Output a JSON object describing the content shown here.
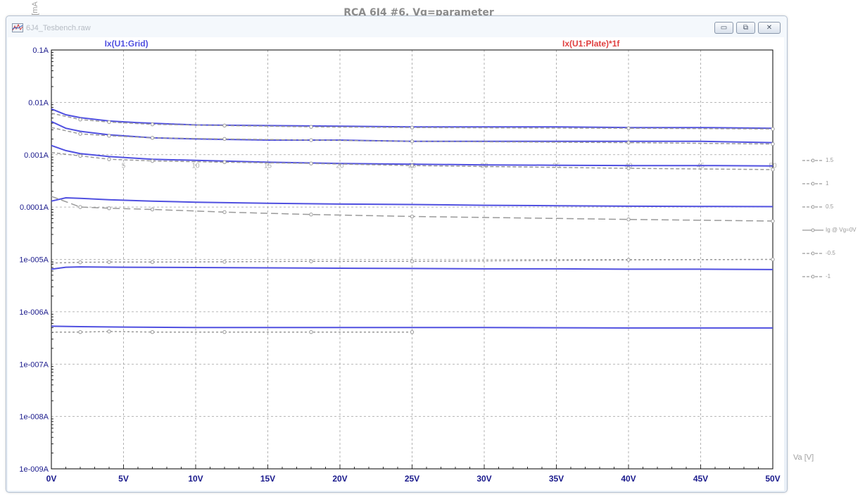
{
  "page": {
    "title": "RCA 6J4 #6, Vg=parameter",
    "left_axis_label": "Ig [mA"
  },
  "window": {
    "title": "6J4_Tesbench.raw",
    "icon": "waveform-icon",
    "buttons": [
      {
        "name": "minimize-button",
        "icon": "minimize-icon",
        "glyph": "▭"
      },
      {
        "name": "restore-button",
        "icon": "restore-icon",
        "glyph": "⧉"
      },
      {
        "name": "close-button",
        "icon": "close-icon",
        "glyph": "✕"
      }
    ]
  },
  "legend_labels": [
    "Ix(U1:Grid)",
    "Ix(U1:Plate)*1f"
  ],
  "side_legend": [
    {
      "label": "1.5",
      "style": "dashed"
    },
    {
      "label": "1",
      "style": "dashed"
    },
    {
      "label": "0.5",
      "style": "dashed"
    },
    {
      "label": "Ig @ Vg=0V",
      "style": "solid"
    },
    {
      "label": "-0.5",
      "style": "dashed"
    },
    {
      "label": "-1",
      "style": "dashed"
    }
  ],
  "xaxis_external_label": "Va [V]",
  "colors": {
    "grid_series": "#5050e0",
    "plate_label": "#e04040",
    "reference": "#9a9a9a",
    "grid_lines": "#a0a0a0",
    "axis": "#000000"
  },
  "chart_data": {
    "type": "line",
    "x_scale": "linear",
    "y_scale": "log",
    "xlim": [
      0,
      50
    ],
    "ylim": [
      1e-09,
      0.1
    ],
    "grid": true,
    "x_tick_labels": [
      "0V",
      "5V",
      "10V",
      "15V",
      "20V",
      "25V",
      "30V",
      "35V",
      "40V",
      "45V",
      "50V"
    ],
    "y_tick_labels": [
      "0.1A",
      "0.01A",
      "0.001A",
      "0.0001A",
      "1e-005A",
      "1e-006A",
      "1e-007A",
      "1e-008A",
      "1e-009A"
    ],
    "inner_x_tick_labels": [
      "5",
      "10",
      "15",
      "20",
      "25",
      "30",
      "35",
      "40",
      "45",
      "50"
    ],
    "series": [
      {
        "name": "Ix(U1:Grid)",
        "style": "solid-blue",
        "points": [
          [
            0,
            0.0075
          ],
          [
            1,
            0.0058
          ],
          [
            2,
            0.0051
          ],
          [
            4,
            0.0044
          ],
          [
            6,
            0.0041
          ],
          [
            10,
            0.0037
          ],
          [
            15,
            0.0036
          ],
          [
            20,
            0.0035
          ],
          [
            25,
            0.0034
          ],
          [
            30,
            0.0034
          ],
          [
            35,
            0.0034
          ],
          [
            40,
            0.0033
          ],
          [
            45,
            0.0033
          ],
          [
            50,
            0.0032
          ]
        ]
      },
      {
        "name": "Ix(U1:Grid)",
        "style": "solid-blue",
        "points": [
          [
            0,
            0.0043
          ],
          [
            1,
            0.0032
          ],
          [
            2,
            0.0028
          ],
          [
            4,
            0.0024
          ],
          [
            7,
            0.0021
          ],
          [
            10,
            0.002
          ],
          [
            15,
            0.0019
          ],
          [
            20,
            0.0019
          ],
          [
            25,
            0.0018
          ],
          [
            30,
            0.0018
          ],
          [
            35,
            0.0018
          ],
          [
            40,
            0.0018
          ],
          [
            45,
            0.0018
          ],
          [
            50,
            0.0017
          ]
        ]
      },
      {
        "name": "Ix(U1:Grid)",
        "style": "solid-blue",
        "points": [
          [
            0,
            0.0015
          ],
          [
            1,
            0.0012
          ],
          [
            2,
            0.00105
          ],
          [
            4,
            0.00092
          ],
          [
            7,
            0.00082
          ],
          [
            10,
            0.00078
          ],
          [
            15,
            0.00072
          ],
          [
            20,
            0.00068
          ],
          [
            25,
            0.00066
          ],
          [
            30,
            0.00064
          ],
          [
            35,
            0.00063
          ],
          [
            40,
            0.00062
          ],
          [
            45,
            0.00062
          ],
          [
            50,
            0.00061
          ]
        ]
      },
      {
        "name": "Ix(U1:Grid)",
        "style": "solid-blue",
        "points": [
          [
            0,
            0.00013
          ],
          [
            1,
            0.00015
          ],
          [
            2,
            0.000147
          ],
          [
            4,
            0.000138
          ],
          [
            7,
            0.00013
          ],
          [
            10,
            0.000124
          ],
          [
            15,
            0.000118
          ],
          [
            20,
            0.000114
          ],
          [
            25,
            0.000112
          ],
          [
            30,
            0.000108
          ],
          [
            35,
            0.000106
          ],
          [
            40,
            0.000104
          ],
          [
            45,
            0.000103
          ],
          [
            50,
            0.000102
          ]
        ]
      },
      {
        "name": "Ix(U1:Grid)",
        "style": "solid-blue",
        "points": [
          [
            0,
            6.5e-06
          ],
          [
            1,
            7.1e-06
          ],
          [
            2,
            7.2e-06
          ],
          [
            5,
            7.1e-06
          ],
          [
            10,
            7e-06
          ],
          [
            15,
            6.9e-06
          ],
          [
            20,
            6.8e-06
          ],
          [
            25,
            6.7e-06
          ],
          [
            30,
            6.6e-06
          ],
          [
            35,
            6.6e-06
          ],
          [
            40,
            6.5e-06
          ],
          [
            45,
            6.5e-06
          ],
          [
            50,
            6.4e-06
          ]
        ]
      },
      {
        "name": "Ix(U1:Grid)",
        "style": "solid-blue",
        "points": [
          [
            0,
            5.3e-07
          ],
          [
            2,
            5.2e-07
          ],
          [
            5,
            5.1e-07
          ],
          [
            10,
            5e-07
          ],
          [
            20,
            5e-07
          ],
          [
            30,
            5e-07
          ],
          [
            40,
            4.9e-07
          ],
          [
            50,
            4.9e-07
          ]
        ]
      },
      {
        "name": "1.5",
        "style": "dashed-gray",
        "points": [
          [
            0,
            0.0062
          ],
          [
            2,
            0.0047
          ],
          [
            4,
            0.0042
          ],
          [
            7,
            0.0038
          ],
          [
            12,
            0.0036
          ],
          [
            18,
            0.0034
          ],
          [
            25,
            0.0033
          ],
          [
            40,
            0.0032
          ],
          [
            50,
            0.0031
          ]
        ]
      },
      {
        "name": "1",
        "style": "dashed-gray",
        "points": [
          [
            0,
            0.0033
          ],
          [
            2,
            0.0025
          ],
          [
            4,
            0.0023
          ],
          [
            7,
            0.0021
          ],
          [
            12,
            0.002
          ],
          [
            18,
            0.0019
          ],
          [
            25,
            0.0018
          ],
          [
            40,
            0.0017
          ],
          [
            50,
            0.0016
          ]
        ]
      },
      {
        "name": "0.5",
        "style": "dashed-gray",
        "points": [
          [
            0,
            0.0011
          ],
          [
            2,
            0.00095
          ],
          [
            4,
            0.00082
          ],
          [
            7,
            0.00076
          ],
          [
            12,
            0.00072
          ],
          [
            18,
            0.00068
          ],
          [
            25,
            0.00062
          ],
          [
            40,
            0.00055
          ],
          [
            50,
            0.00052
          ]
        ]
      },
      {
        "name": "Ig @ Vg=0V",
        "style": "longdash-gray",
        "points": [
          [
            0,
            0.00016
          ],
          [
            2,
            0.0001
          ],
          [
            4,
            9.5e-05
          ],
          [
            7,
            9e-05
          ],
          [
            12,
            8e-05
          ],
          [
            18,
            7.2e-05
          ],
          [
            25,
            6.6e-05
          ],
          [
            40,
            5.8e-05
          ],
          [
            50,
            5.4e-05
          ]
        ]
      },
      {
        "name": "-0.5",
        "style": "dotted-gray",
        "points": [
          [
            0,
            8.5e-06
          ],
          [
            2,
            8.8e-06
          ],
          [
            4,
            8.9e-06
          ],
          [
            7,
            8.9e-06
          ],
          [
            12,
            9e-06
          ],
          [
            18,
            9.2e-06
          ],
          [
            25,
            9.2e-06
          ],
          [
            40,
            9.8e-06
          ],
          [
            50,
            1e-05
          ]
        ]
      },
      {
        "name": "-1",
        "style": "dotted-gray",
        "points": [
          [
            0,
            4.1e-07
          ],
          [
            2,
            4.1e-07
          ],
          [
            4,
            4.2e-07
          ],
          [
            7,
            4.1e-07
          ],
          [
            12,
            4.1e-07
          ],
          [
            18,
            4.1e-07
          ],
          [
            25,
            4.1e-07
          ]
        ]
      }
    ]
  }
}
